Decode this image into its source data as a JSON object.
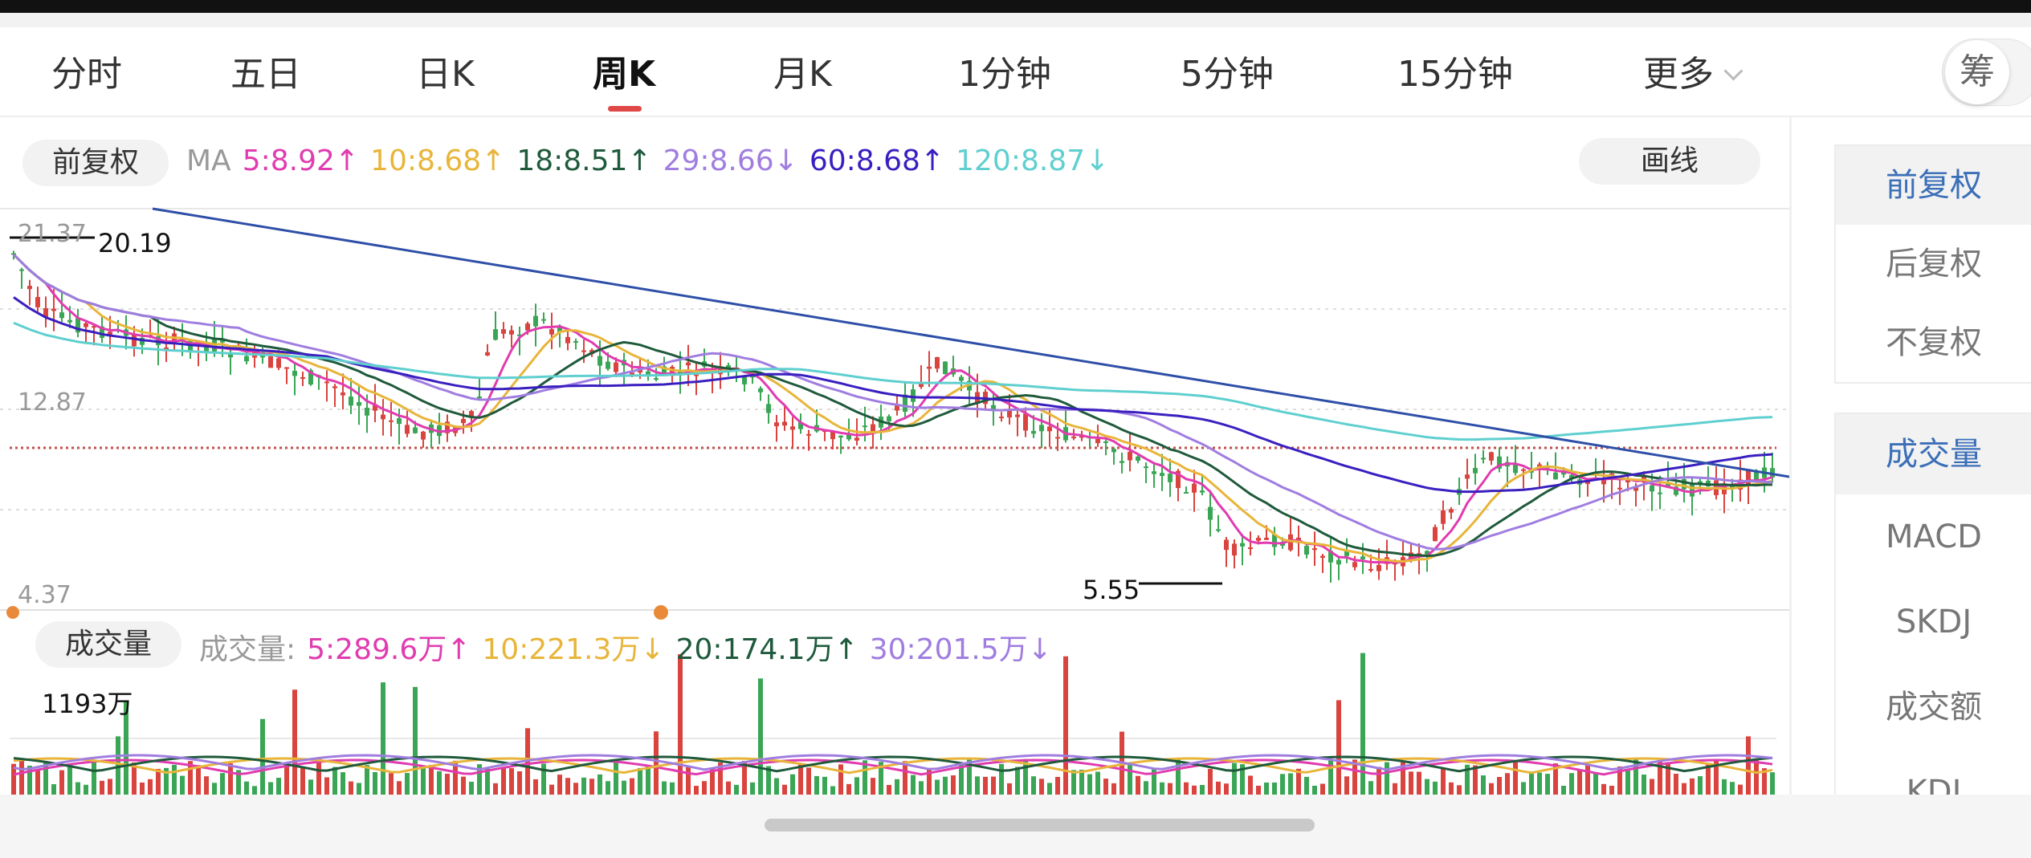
{
  "tabs": [
    {
      "label": "分时",
      "active": false
    },
    {
      "label": "五日",
      "active": false
    },
    {
      "label": "日K",
      "active": false
    },
    {
      "label": "周K",
      "active": true
    },
    {
      "label": "月K",
      "active": false
    },
    {
      "label": "1分钟",
      "active": false
    },
    {
      "label": "5分钟",
      "active": false
    },
    {
      "label": "15分钟",
      "active": false
    },
    {
      "label": "更多",
      "active": false
    }
  ],
  "chip_toggle": {
    "label": "筹"
  },
  "price_panel": {
    "adjust_label": "前复权",
    "draw_button": "画线",
    "ma_prefix": "MA",
    "ma": [
      {
        "text": "5:8.92↑",
        "color": "#e03cb0"
      },
      {
        "text": "10:8.68↑",
        "color": "#e8b53a"
      },
      {
        "text": "18:8.51↑",
        "color": "#1f5a3c"
      },
      {
        "text": "29:8.66↓",
        "color": "#a07de0"
      },
      {
        "text": "60:8.68↑",
        "color": "#3a1fc0"
      },
      {
        "text": "120:8.87↓",
        "color": "#5fcfcf"
      }
    ],
    "axis": {
      "high": "21.37",
      "mid": "12.87",
      "low": "4.37"
    },
    "annotations": {
      "max": "20.19",
      "min": "5.55"
    }
  },
  "volume_panel": {
    "label": "成交量",
    "prefix": "成交量:",
    "ma": [
      {
        "text": "5:289.6万↑",
        "color": "#e03cb0"
      },
      {
        "text": "10:221.3万↓",
        "color": "#e8b53a"
      },
      {
        "text": "20:174.1万↑",
        "color": "#1f5a3c"
      },
      {
        "text": "30:201.5万↓",
        "color": "#a07de0"
      }
    ],
    "axis_max": "1193万"
  },
  "right_panel": {
    "adjust": [
      {
        "label": "前复权",
        "active": true
      },
      {
        "label": "后复权",
        "active": false
      },
      {
        "label": "不复权",
        "active": false
      }
    ],
    "indicators": [
      {
        "label": "成交量",
        "active": true
      },
      {
        "label": "MACD",
        "active": false
      },
      {
        "label": "SKDJ",
        "active": false
      },
      {
        "label": "成交额",
        "active": false
      },
      {
        "label": "KDJ",
        "active": false
      }
    ]
  },
  "colors": {
    "up": "#d9443f",
    "down": "#3aa655",
    "trendline": "#2e4fa8",
    "ref_line": "#c0524d"
  }
}
